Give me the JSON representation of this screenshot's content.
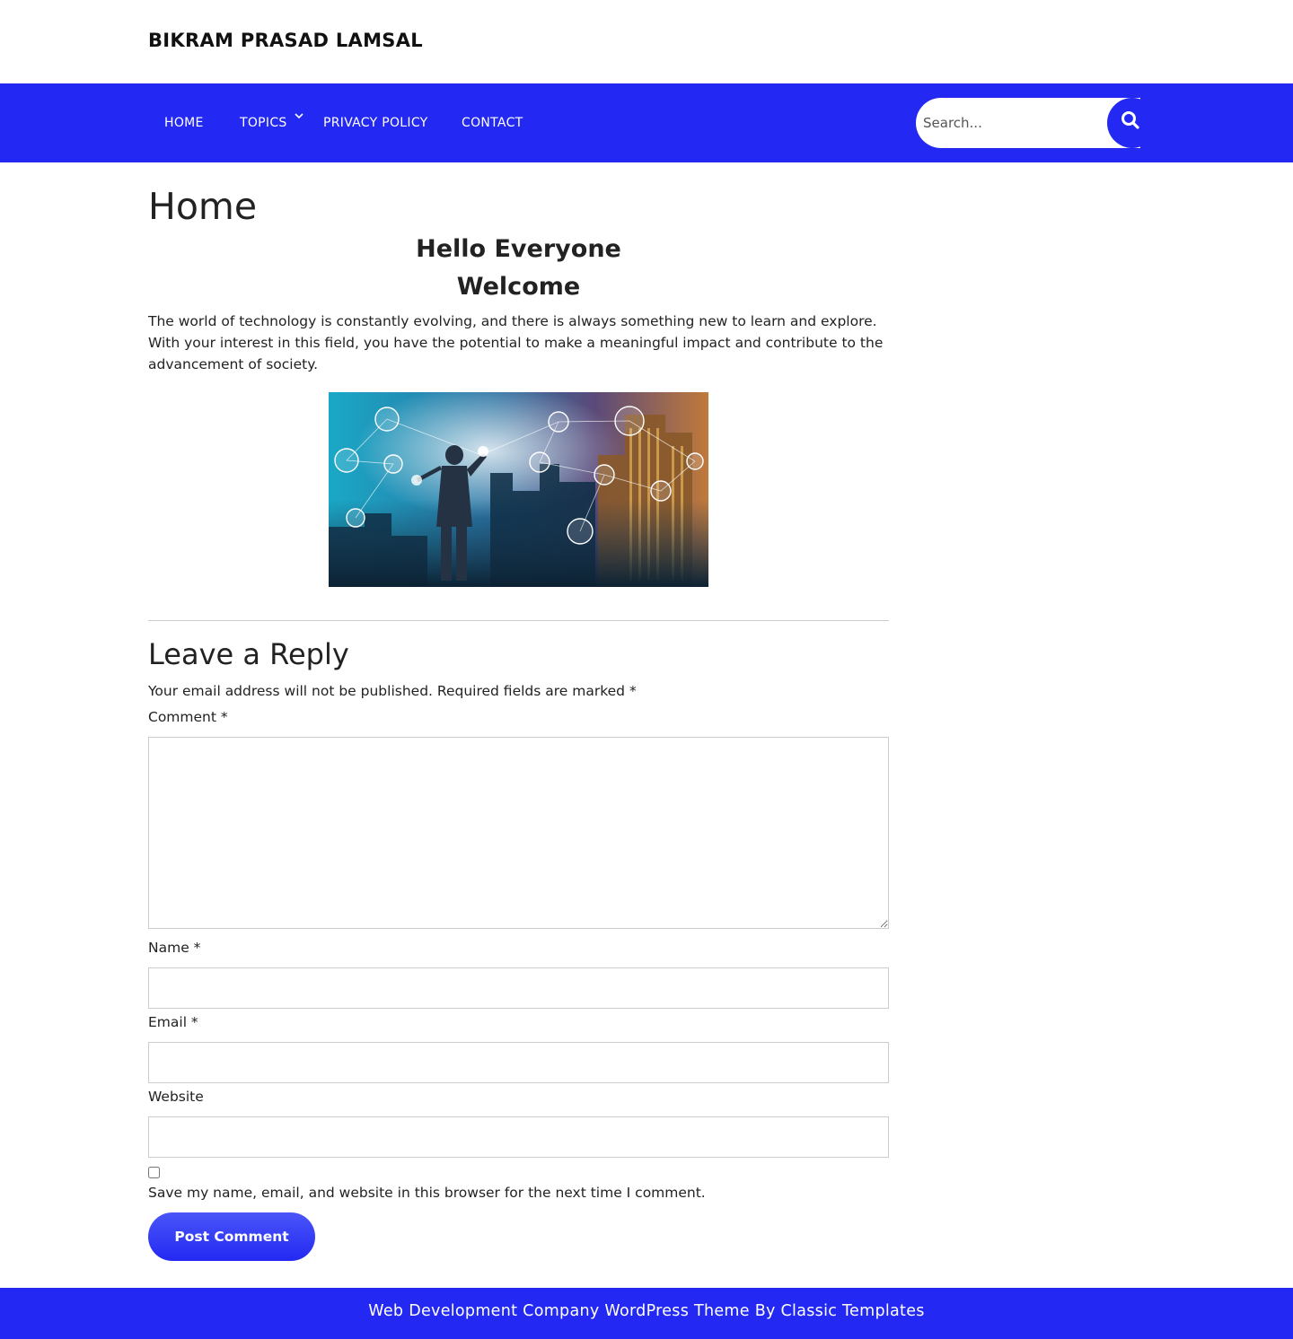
{
  "header": {
    "site_title": "BIKRAM PRASAD LAMSAL"
  },
  "nav": {
    "items": [
      {
        "label": "HOME"
      },
      {
        "label": "TOPICS"
      },
      {
        "label": "PRIVACY POLICY"
      },
      {
        "label": "CONTACT"
      }
    ],
    "search": {
      "placeholder": "Search...",
      "value": ""
    }
  },
  "page": {
    "title": "Home",
    "heading": "Hello Everyone",
    "subheading": "Welcome",
    "intro": "The world of technology is constantly evolving, and there is always something new to learn and explore. With your interest in this field, you have the potential to make a meaningful impact and contribute to the advancement of society."
  },
  "comments": {
    "title": "Leave a Reply",
    "notes": "Your email address will not be published. Required fields are marked *",
    "comment_label": "Comment *",
    "name_label": "Name *",
    "email_label": "Email *",
    "website_label": "Website",
    "consent_label": "Save my name, email, and website in this browser for the next time I comment.",
    "submit_label": "Post Comment"
  },
  "footer": {
    "text": "Web Development Company WordPress Theme By Classic Templates"
  },
  "colors": {
    "accent": "#2329f2",
    "text": "#222222",
    "border": "#cccccc"
  }
}
